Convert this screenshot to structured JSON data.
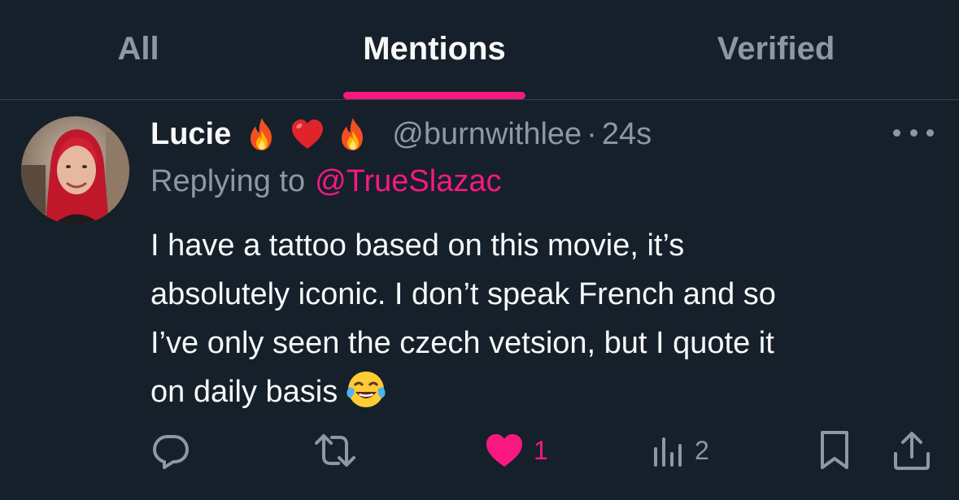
{
  "tabs": [
    {
      "label": "All",
      "active": false
    },
    {
      "label": "Mentions",
      "active": true
    },
    {
      "label": "Verified",
      "active": false
    }
  ],
  "accent_color": "#f91880",
  "background_color": "#15202b",
  "tweet": {
    "author_name": "Lucie",
    "name_emojis": [
      "fire-emoji",
      "red-heart-emoji",
      "fire-emoji"
    ],
    "handle": "@burnwithlee",
    "separator": "·",
    "time": "24s",
    "replying_prefix": "Replying to",
    "replying_to": "@TrueSlazac",
    "text_lines": [
      "I have a tattoo based on this movie, it’s",
      "absolutely iconic. I don’t speak French and so",
      "I’ve only seen the czech vetsion, but I quote it",
      "on daily basis"
    ],
    "text_end_emoji": "face-with-tears-of-joy-emoji"
  },
  "actions": {
    "reply": {
      "icon": "comment-icon"
    },
    "retweet": {
      "icon": "retweet-icon"
    },
    "like": {
      "icon": "heart-icon",
      "count": "1",
      "liked": true
    },
    "views": {
      "icon": "analytics-icon",
      "count": "2"
    },
    "bookmark": {
      "icon": "bookmark-icon"
    },
    "share": {
      "icon": "share-icon"
    }
  }
}
